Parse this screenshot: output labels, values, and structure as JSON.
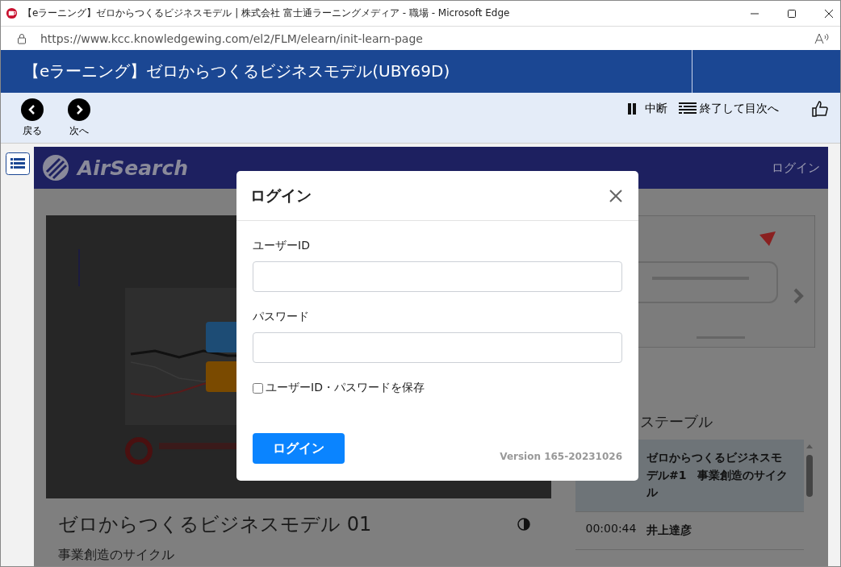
{
  "browser": {
    "title": "【eラーニング】ゼロからつくるビジネスモデル | 株式会社 富士通ラーニングメディア - 職場 - Microsoft Edge",
    "url": "https://www.kcc.knowledgewing.com/el2/FLM/elearn/init-learn-page"
  },
  "course_header": {
    "title": "【eラーニング】ゼロからつくるビジネスモデル(UBY69D)"
  },
  "toolbar": {
    "back": "戻る",
    "next": "次へ",
    "pause": "中断",
    "finish": "終了して目次へ"
  },
  "site": {
    "brand": "AirSearch",
    "login_link": "ログイン"
  },
  "video": {
    "title": "ゼロからつくるビジネスモデル 01",
    "subtitle": "事業創造のサイクル"
  },
  "timetable": {
    "heading": "ステーブル",
    "rows": [
      {
        "title": "ゼロからつくるビジネスモデル#1　事業創造のサイクル",
        "selected": true
      },
      {
        "time": "00:00:44",
        "title": "井上達彦",
        "selected": false
      }
    ]
  },
  "login_dialog": {
    "title": "ログイン",
    "fields": [
      {
        "label": "ユーザーID"
      },
      {
        "label": "パスワード"
      }
    ],
    "remember": {
      "label": "ユーザーID・パスワードを保存",
      "checked": false
    },
    "submit": "ログイン",
    "version": "Version 165-20231026"
  }
}
